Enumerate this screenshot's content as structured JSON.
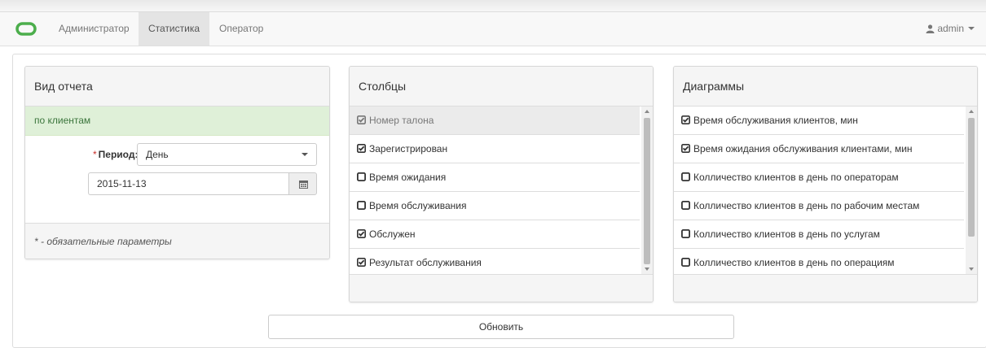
{
  "navbar": {
    "brand_icon": "link-logo-icon",
    "brand_color": "#4cae4c",
    "items": [
      {
        "label": "Администратор",
        "active": false
      },
      {
        "label": "Статистика",
        "active": true
      },
      {
        "label": "Оператор",
        "active": false
      }
    ],
    "user": {
      "icon": "user-icon",
      "label": "admin"
    }
  },
  "report_panel": {
    "title": "Вид отчета",
    "selected_type": "по клиентам",
    "period_required_mark": "*",
    "period_label": "Период:",
    "period_value": "День",
    "date_value": "2015-11-13",
    "calendar_icon": "calendar-icon",
    "footer_note": "* - обязательные параметры"
  },
  "columns_panel": {
    "title": "Столбцы",
    "items": [
      {
        "label": "Номер талона",
        "checked": true,
        "highlighted": true
      },
      {
        "label": "Зарегистрирован",
        "checked": true
      },
      {
        "label": "Время ожидания",
        "checked": false
      },
      {
        "label": "Время обслуживания",
        "checked": false
      },
      {
        "label": "Обслужен",
        "checked": true
      },
      {
        "label": "Результат обслуживания",
        "checked": true
      }
    ]
  },
  "charts_panel": {
    "title": "Диаграммы",
    "items": [
      {
        "label": "Время обслуживания клиентов, мин",
        "checked": true
      },
      {
        "label": "Время ожидания обслуживания клиентами, мин",
        "checked": true
      },
      {
        "label": "Колличество клиентов в день по операторам",
        "checked": false
      },
      {
        "label": "Колличество клиентов в день по рабочим местам",
        "checked": false
      },
      {
        "label": "Колличество клиентов в день по услугам",
        "checked": false
      },
      {
        "label": "Колличество клиентов в день по операциям",
        "checked": false
      }
    ]
  },
  "refresh_label": "Обновить"
}
